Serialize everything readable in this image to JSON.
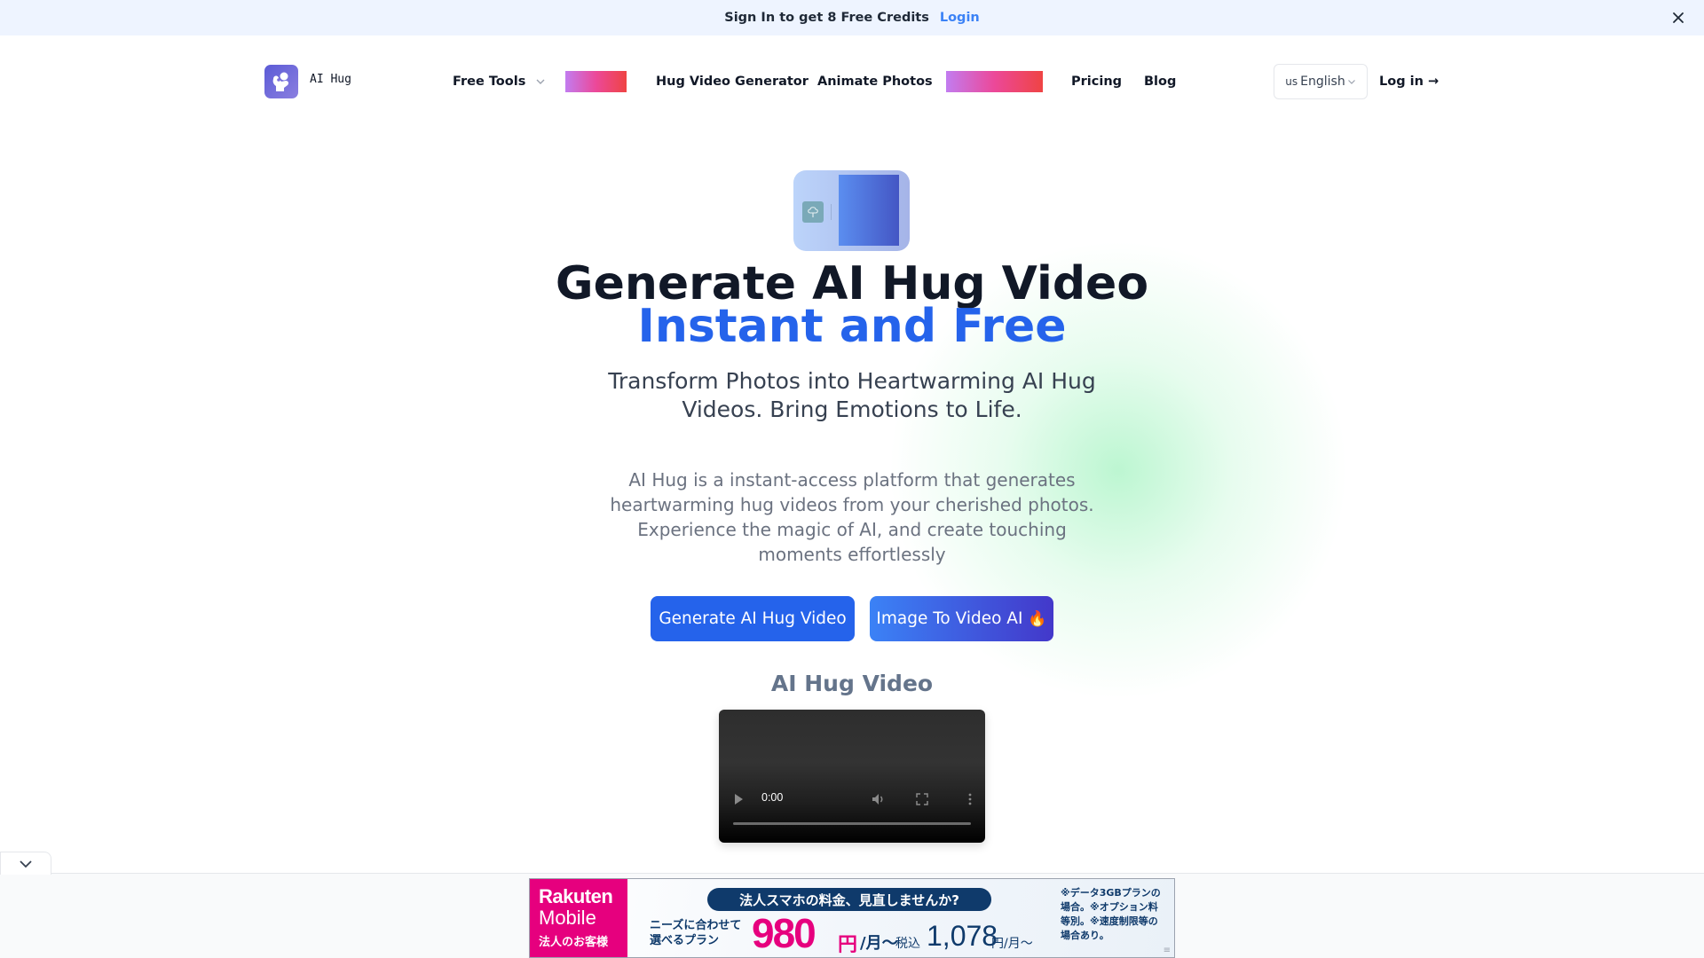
{
  "banner": {
    "text": "Sign In to get 8 Free Credits",
    "login_label": "Login",
    "close_icon": "close-icon"
  },
  "nav": {
    "logo_text": "AI Hug",
    "logo_icon": "hug-logo-icon",
    "items": [
      {
        "label": "Free Tools",
        "has_dropdown": true
      },
      {
        "label": "Hug Video Generator"
      },
      {
        "label": "Animate Photos"
      },
      {
        "label": "Pricing"
      },
      {
        "label": "Blog"
      }
    ],
    "language": {
      "flag": "us",
      "label": "English"
    },
    "login_label": "Log in →"
  },
  "hero": {
    "title_line1": "Generate AI Hug Video",
    "title_line2": "Instant and Free",
    "subtitle": "Transform Photos into Heartwarming AI Hug Videos. Bring Emotions to Life.",
    "description": "AI Hug is a instant-access platform that generates heartwarming hug videos from your cherished photos. Experience the magic of AI, and create touching moments effortlessly",
    "primary_button": "Generate AI Hug Video",
    "secondary_button": "Image To Video AI",
    "secondary_button_emoji": "🔥"
  },
  "video_section": {
    "title": "AI Hug Video",
    "time": "0:00",
    "progress": 0
  },
  "ad": {
    "brand_line1": "Rakuten",
    "brand_line2": "Mobile",
    "brand_line3": "法人のお客様",
    "headline": "法人スマホの料金、見直しませんか?",
    "needs_line1": "ニーズに合わせて",
    "needs_line2": "選べるプラン",
    "price": "980",
    "price_yen": "円",
    "per_month": "/月〜",
    "tax_label": "税込",
    "tax_price": "1,078",
    "tax_suffix": "円/月〜",
    "note": "※データ3GBプランの場合。※オプション料等別。※速度制限等の場合あり。"
  },
  "colors": {
    "accent_blue": "#2563eb",
    "banner_bg": "#eef4ff",
    "brand_pink": "#e6007e"
  }
}
